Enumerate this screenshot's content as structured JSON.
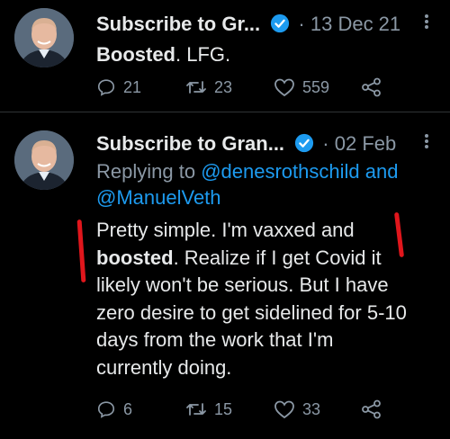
{
  "tweets": [
    {
      "author": "Subscribe to Gr...",
      "separator": "·",
      "date": "13 Dec 21",
      "text_bold": "Boosted",
      "text_rest": ". LFG.",
      "replies": "21",
      "retweets": "23",
      "likes": "559"
    },
    {
      "author": "Subscribe to Gran...",
      "separator": "·",
      "date": "02 Feb",
      "replying_prefix": "Replying to",
      "mention_1": "@denesrothschild",
      "and_word": "and",
      "mention_2": "@ManuelVeth",
      "lines": {
        "l1": "Pretty simple. I'm vaxxed and",
        "l2_bold": "boosted",
        "l2_rest": ". Realize if I get Covid it",
        "l3": "likely won't be serious. But I have",
        "l4": "zero desire to get sidelined for 5-10",
        "l5": "days from the work that I'm",
        "l6": "currently doing."
      },
      "replies": "6",
      "retweets": "15",
      "likes": "33"
    }
  ],
  "icons": {
    "more": "more-icon",
    "verified": "verified-badge-icon",
    "reply": "reply-icon",
    "retweet": "retweet-icon",
    "like": "like-icon",
    "share": "share-icon"
  },
  "colors": {
    "background": "#000000",
    "text": "#e7e9ea",
    "secondary": "#8b98a5",
    "link": "#1d9bf0",
    "annotation": "#e0161c"
  }
}
